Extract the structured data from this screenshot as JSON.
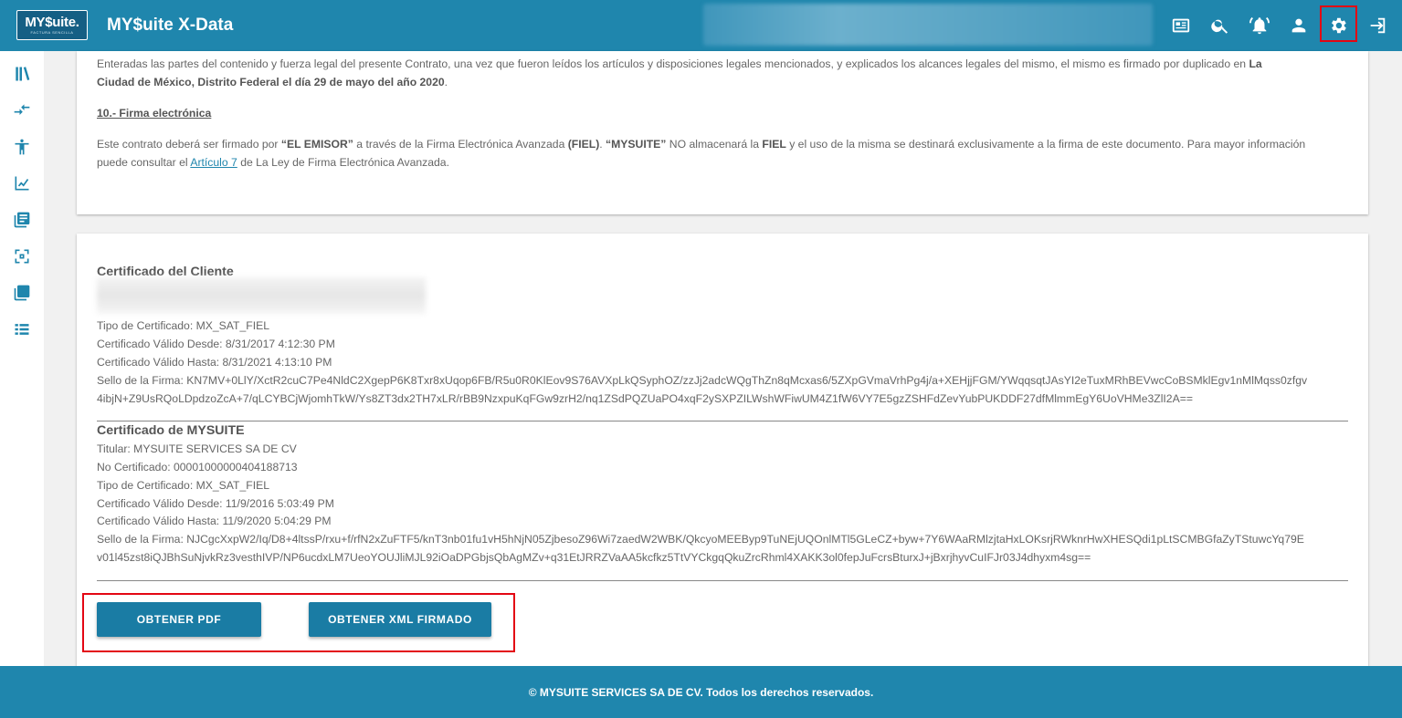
{
  "header": {
    "logo_text": "MY$uite.",
    "logo_sub": "FACTURA SENCILLA",
    "title": "MY$uite X-Data",
    "icons": [
      "newspaper-icon",
      "search-icon",
      "bell-icon",
      "user-icon",
      "settings-icon",
      "logout-icon"
    ]
  },
  "sidebar": {
    "icons": [
      "library-icon",
      "transfer-icon",
      "figure-icon",
      "chart-line-icon",
      "document-list-icon",
      "scan-icon",
      "copy-icon",
      "list-icon"
    ]
  },
  "contract": {
    "para1_part1": "Enteradas las partes del contenido y fuerza legal del presente Contrato, una vez que fueron leídos los artículos y disposiciones legales mencionados, y explicados los alcances legales del mismo, el mismo es firmado por duplicado en ",
    "para1_bold1": "La",
    "para1_bold2": "Ciudad de México, Distrito Federal el día 29 de mayo del año 2020",
    "para1_end": ".",
    "section_heading": "10.- Firma electrónica",
    "para2_a": "Este contrato deberá ser firmado por ",
    "para2_b": "“EL EMISOR”",
    "para2_c": " a través de la Firma Electrónica Avanzada ",
    "para2_d": "(FIEL)",
    "para2_e": ". ",
    "para2_f": "“MYSUITE”",
    "para2_g": " NO almacenará la ",
    "para2_h": "FIEL",
    "para2_i": " y el uso de la misma se destinará exclusivamente a la firma de este documento. Para mayor información",
    "para2_j": "puede consultar el ",
    "para2_link": "Artículo 7",
    "para2_k": " de La Ley de Firma Electrónica Avanzada."
  },
  "cliente": {
    "heading": "Certificado del Cliente",
    "tipo": "Tipo de Certificado: MX_SAT_FIEL",
    "desde": "Certificado Válido Desde: 8/31/2017 4:12:30 PM",
    "hasta": "Certificado Válido Hasta: 8/31/2021 4:13:10 PM",
    "sello_1": "Sello de la Firma: KN7MV+0LlY/XctR2cuC7Pe4NldC2XgepP6K8Txr8xUqop6FB/R5u0R0KlEov9S76AVXpLkQSyphOZ/zzJj2adcWQgThZn8qMcxas6/5ZXpGVmaVrhPg4j/a+XEHjjFGM/YWqqsqtJAsYI2eTuxMRhBEVwcCoBSMklEgv1nMlMqss0zfgv",
    "sello_2": "4ibjN+Z9UsRQoLDpdzoZcA+7/qLCYBCjWjomhTkW/Ys8ZT3dx2TH7xLR/rBB9NzxpuKqFGw9zrH2/nq1ZSdPQZUaPO4xqF2ySXPZILWshWFiwUM4Z1fW6VY7E5gzZSHFdZevYubPUKDDF27dfMlmmEgY6UoVHMe3ZlI2A=="
  },
  "mysuite": {
    "heading": "Certificado de MYSUITE",
    "titular": "Titular: MYSUITE SERVICES SA DE CV",
    "no_cert": "No Certificado: 00001000000404188713",
    "tipo": "Tipo de Certificado: MX_SAT_FIEL",
    "desde": "Certificado Válido Desde: 11/9/2016 5:03:49 PM",
    "hasta": "Certificado Válido Hasta: 11/9/2020 5:04:29 PM",
    "sello_1": "Sello de la Firma: NJCgcXxpW2/Iq/D8+4ltssP/rxu+f/rfN2xZuFTF5/knT3nb01fu1vH5hNjN05ZjbesoZ96Wi7zaedW2WBK/QkcyoMEEByp9TuNEjUQOnlMTl5GLeCZ+byw+7Y6WAaRMlzjtaHxLOKsrjRWknrHwXHESQdi1pLtSCMBGfaZyTStuwcYq79E",
    "sello_2": "v01l45zst8iQJBhSuNjvkRz3vesthIVP/NP6ucdxLM7UeoYOUJliMJL92iOaDPGbjsQbAgMZv+q31EtJRRZVaAA5kcfkz5TtVYCkgqQkuZrcRhml4XAKK3ol0fepJuFcrsBturxJ+jBxrjhyvCuIFJr03J4dhyxm4sg=="
  },
  "actions": {
    "pdf_label": "OBTENER PDF",
    "xml_label": "OBTENER XML FIRMADO"
  },
  "footer": {
    "text": "© MYSUITE SERVICES SA DE CV. Todos los derechos reservados."
  },
  "colors": {
    "primary": "#1f86ad",
    "highlight": "#e30613"
  }
}
